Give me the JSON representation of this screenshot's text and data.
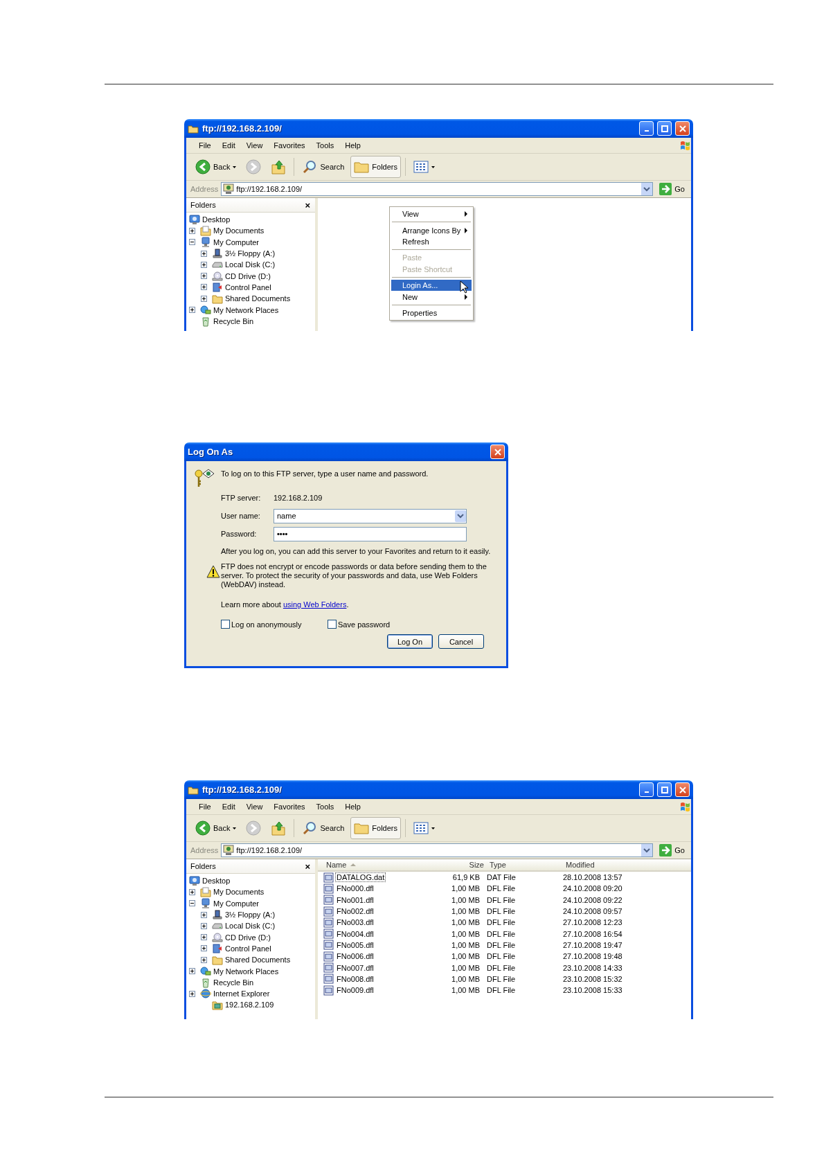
{
  "screens": [
    {
      "kind": "explorer",
      "title": "ftp://192.168.2.109/",
      "menu": [
        "File",
        "Edit",
        "View",
        "Favorites",
        "Tools",
        "Help"
      ],
      "toolbar": {
        "back_label": "Back",
        "search_label": "Search",
        "folders_label": "Folders",
        "folders_on": true
      },
      "address": {
        "label": "Address",
        "value": "ftp://192.168.2.109/",
        "go_label": "Go"
      },
      "folders_pane": {
        "title": "Folders",
        "close": "×",
        "tree": [
          {
            "label": "Desktop",
            "kind": "desktop",
            "children": [
              {
                "label": "My Documents",
                "kind": "documents",
                "expanded": false
              },
              {
                "label": "My Computer",
                "kind": "computer",
                "expanded": true,
                "children": [
                  {
                    "label": "3½ Floppy (A:)",
                    "kind": "floppy",
                    "expanded": false
                  },
                  {
                    "label": "Local Disk (C:)",
                    "kind": "disk",
                    "expanded": false
                  },
                  {
                    "label": "CD Drive (D:)",
                    "kind": "cd",
                    "expanded": false
                  },
                  {
                    "label": "Control Panel",
                    "kind": "control_panel",
                    "expanded": false
                  },
                  {
                    "label": "Shared Documents",
                    "kind": "folder",
                    "expanded": false
                  }
                ]
              },
              {
                "label": "My Network Places",
                "kind": "network",
                "expanded": false
              },
              {
                "label": "Recycle Bin",
                "kind": "recycle"
              }
            ]
          }
        ]
      },
      "content": {
        "kind": "context_menu",
        "items": [
          {
            "kind": "item",
            "label": "View",
            "submenu": true,
            "disabled": false,
            "selected": false
          },
          {
            "kind": "separator"
          },
          {
            "kind": "item",
            "label": "Arrange Icons By",
            "submenu": true,
            "disabled": false,
            "selected": false
          },
          {
            "kind": "item",
            "label": "Refresh",
            "submenu": false,
            "disabled": false,
            "selected": false
          },
          {
            "kind": "separator"
          },
          {
            "kind": "item",
            "label": "Paste",
            "submenu": false,
            "disabled": true,
            "selected": false
          },
          {
            "kind": "item",
            "label": "Paste Shortcut",
            "submenu": false,
            "disabled": true,
            "selected": false
          },
          {
            "kind": "separator"
          },
          {
            "kind": "item",
            "label": "Login As...",
            "submenu": false,
            "disabled": false,
            "selected": true
          },
          {
            "kind": "item",
            "label": "New",
            "submenu": true,
            "disabled": false,
            "selected": false
          },
          {
            "kind": "separator"
          },
          {
            "kind": "item",
            "label": "Properties",
            "submenu": false,
            "disabled": false,
            "selected": false
          }
        ]
      }
    },
    {
      "kind": "logon_dialog",
      "title": "Log On As",
      "intro": "To log on to this FTP server, type a user name and password.",
      "fields": [
        {
          "kind": "static",
          "label": "FTP server:",
          "value": "192.168.2.109"
        },
        {
          "kind": "combo",
          "label": "User name:",
          "value": "name"
        },
        {
          "kind": "password",
          "label": "Password:",
          "value": "••••"
        }
      ],
      "info": "After you log on, you can add this server to your Favorites and return to it easily.",
      "warning": "FTP does not encrypt or encode passwords or data before sending them to the server.  To protect the security of your passwords and data, use Web Folders (WebDAV) instead.",
      "learn_more": {
        "text": "Learn more about ",
        "link": "using Web Folders",
        "after": "."
      },
      "checkboxes": [
        {
          "label": "Log on anonymously",
          "checked": false
        },
        {
          "label": "Save password",
          "checked": false
        }
      ],
      "buttons": [
        {
          "label": "Log On",
          "default": true
        },
        {
          "label": "Cancel",
          "default": false
        }
      ]
    },
    {
      "kind": "explorer",
      "title": "ftp://192.168.2.109/",
      "menu": [
        "File",
        "Edit",
        "View",
        "Favorites",
        "Tools",
        "Help"
      ],
      "toolbar": {
        "back_label": "Back",
        "search_label": "Search",
        "folders_label": "Folders",
        "folders_on": true
      },
      "address": {
        "label": "Address",
        "value": "ftp://192.168.2.109/",
        "go_label": "Go"
      },
      "folders_pane": {
        "title": "Folders",
        "close": "×",
        "tree": [
          {
            "label": "Desktop",
            "kind": "desktop",
            "children": [
              {
                "label": "My Documents",
                "kind": "documents",
                "expanded": false
              },
              {
                "label": "My Computer",
                "kind": "computer",
                "expanded": true,
                "children": [
                  {
                    "label": "3½ Floppy (A:)",
                    "kind": "floppy",
                    "expanded": false
                  },
                  {
                    "label": "Local Disk (C:)",
                    "kind": "disk",
                    "expanded": false
                  },
                  {
                    "label": "CD Drive (D:)",
                    "kind": "cd",
                    "expanded": false
                  },
                  {
                    "label": "Control Panel",
                    "kind": "control_panel",
                    "expanded": false
                  },
                  {
                    "label": "Shared Documents",
                    "kind": "folder",
                    "expanded": false
                  }
                ]
              },
              {
                "label": "My Network Places",
                "kind": "network",
                "expanded": false
              },
              {
                "label": "Recycle Bin",
                "kind": "recycle"
              },
              {
                "label": "Internet Explorer",
                "kind": "ie",
                "expanded": false,
                "children": [
                  {
                    "label": "192.168.2.109",
                    "kind": "ftp"
                  }
                ]
              }
            ]
          }
        ]
      },
      "content": {
        "kind": "file_list",
        "columns": [
          {
            "label": "Name",
            "sorted": true
          },
          {
            "label": "Size",
            "sorted": false
          },
          {
            "label": "Type",
            "sorted": false
          },
          {
            "label": "Modified",
            "sorted": false
          }
        ],
        "rows": [
          {
            "name": "DATALOG.dat",
            "size": "61,9 KB",
            "type": "DAT File",
            "modified": "28.10.2008 13:57",
            "focused": true
          },
          {
            "name": "FNo000.dfl",
            "size": "1,00 MB",
            "type": "DFL File",
            "modified": "24.10.2008 09:20",
            "focused": false
          },
          {
            "name": "FNo001.dfl",
            "size": "1,00 MB",
            "type": "DFL File",
            "modified": "24.10.2008 09:22",
            "focused": false
          },
          {
            "name": "FNo002.dfl",
            "size": "1,00 MB",
            "type": "DFL File",
            "modified": "24.10.2008 09:57",
            "focused": false
          },
          {
            "name": "FNo003.dfl",
            "size": "1,00 MB",
            "type": "DFL File",
            "modified": "27.10.2008 12:23",
            "focused": false
          },
          {
            "name": "FNo004.dfl",
            "size": "1,00 MB",
            "type": "DFL File",
            "modified": "27.10.2008 16:54",
            "focused": false
          },
          {
            "name": "FNo005.dfl",
            "size": "1,00 MB",
            "type": "DFL File",
            "modified": "27.10.2008 19:47",
            "focused": false
          },
          {
            "name": "FNo006.dfl",
            "size": "1,00 MB",
            "type": "DFL File",
            "modified": "27.10.2008 19:48",
            "focused": false
          },
          {
            "name": "FNo007.dfl",
            "size": "1,00 MB",
            "type": "DFL File",
            "modified": "23.10.2008 14:33",
            "focused": false
          },
          {
            "name": "FNo008.dfl",
            "size": "1,00 MB",
            "type": "DFL File",
            "modified": "23.10.2008 15:32",
            "focused": false
          },
          {
            "name": "FNo009.dfl",
            "size": "1,00 MB",
            "type": "DFL File",
            "modified": "23.10.2008 15:33",
            "focused": false
          }
        ]
      }
    }
  ]
}
